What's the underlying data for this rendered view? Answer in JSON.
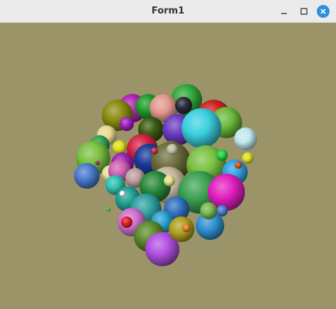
{
  "window": {
    "title": "Form1",
    "controls": {
      "minimize": "minimize-icon",
      "maximize": "maximize-icon",
      "close": "close-icon"
    },
    "accent_color": "#2e8fe0"
  },
  "canvas": {
    "background_color": "#9a9468",
    "content": "3d-sphere-cluster-render"
  }
}
